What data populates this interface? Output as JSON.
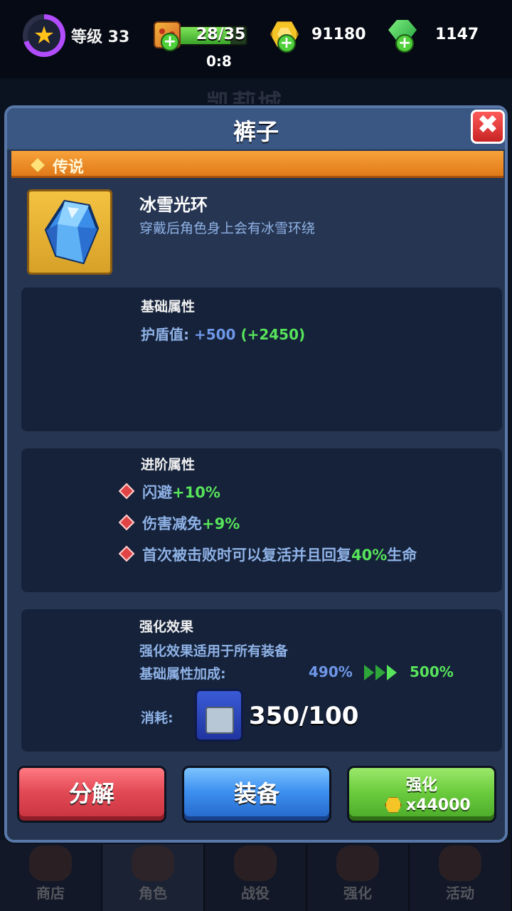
{
  "hud": {
    "level_label": "等级 33",
    "energy": "28/35",
    "energy_fraction": 0.8,
    "energy_timer": "0:8",
    "gold": "91180",
    "gems": "1147",
    "background_title": "凯莉城"
  },
  "nav": {
    "items": [
      {
        "label": "商店"
      },
      {
        "label": "角色"
      },
      {
        "label": "战役"
      },
      {
        "label": "强化"
      },
      {
        "label": "活动"
      }
    ]
  },
  "modal": {
    "title": "裤子",
    "close_symbol": "✖",
    "rarity": "传说",
    "item": {
      "name": "冰雪光环",
      "description": "穿戴后角色身上会有冰雪环绕",
      "icon": "ice-crystal-icon"
    },
    "base_attributes": {
      "title": "基础属性",
      "label": "护盾值:",
      "value": "+500",
      "bonus": "(+2450)"
    },
    "advanced_attributes": {
      "title": "进阶属性",
      "lines": [
        {
          "text": "闪避",
          "value": "+10%",
          "suffix": ""
        },
        {
          "text": "伤害减免",
          "value": "+9%",
          "suffix": ""
        },
        {
          "text": "首次被击败时可以复活并且回复",
          "value": "40%",
          "suffix": "生命"
        }
      ]
    },
    "enhance": {
      "title": "强化效果",
      "note": "强化效果适用于所有装备",
      "bonus_label": "基础属性加成:",
      "from": "490%",
      "to": "500%",
      "consume_label": "消耗:",
      "consume_count": "350/100"
    },
    "buttons": {
      "decompose": "分解",
      "equip": "装备",
      "enhance": "强化",
      "enhance_cost": "x44000"
    }
  },
  "colors": {
    "rarity_orange": "#f7a23a",
    "stat_blue": "#6f97e8",
    "stat_green": "#57e35a"
  }
}
